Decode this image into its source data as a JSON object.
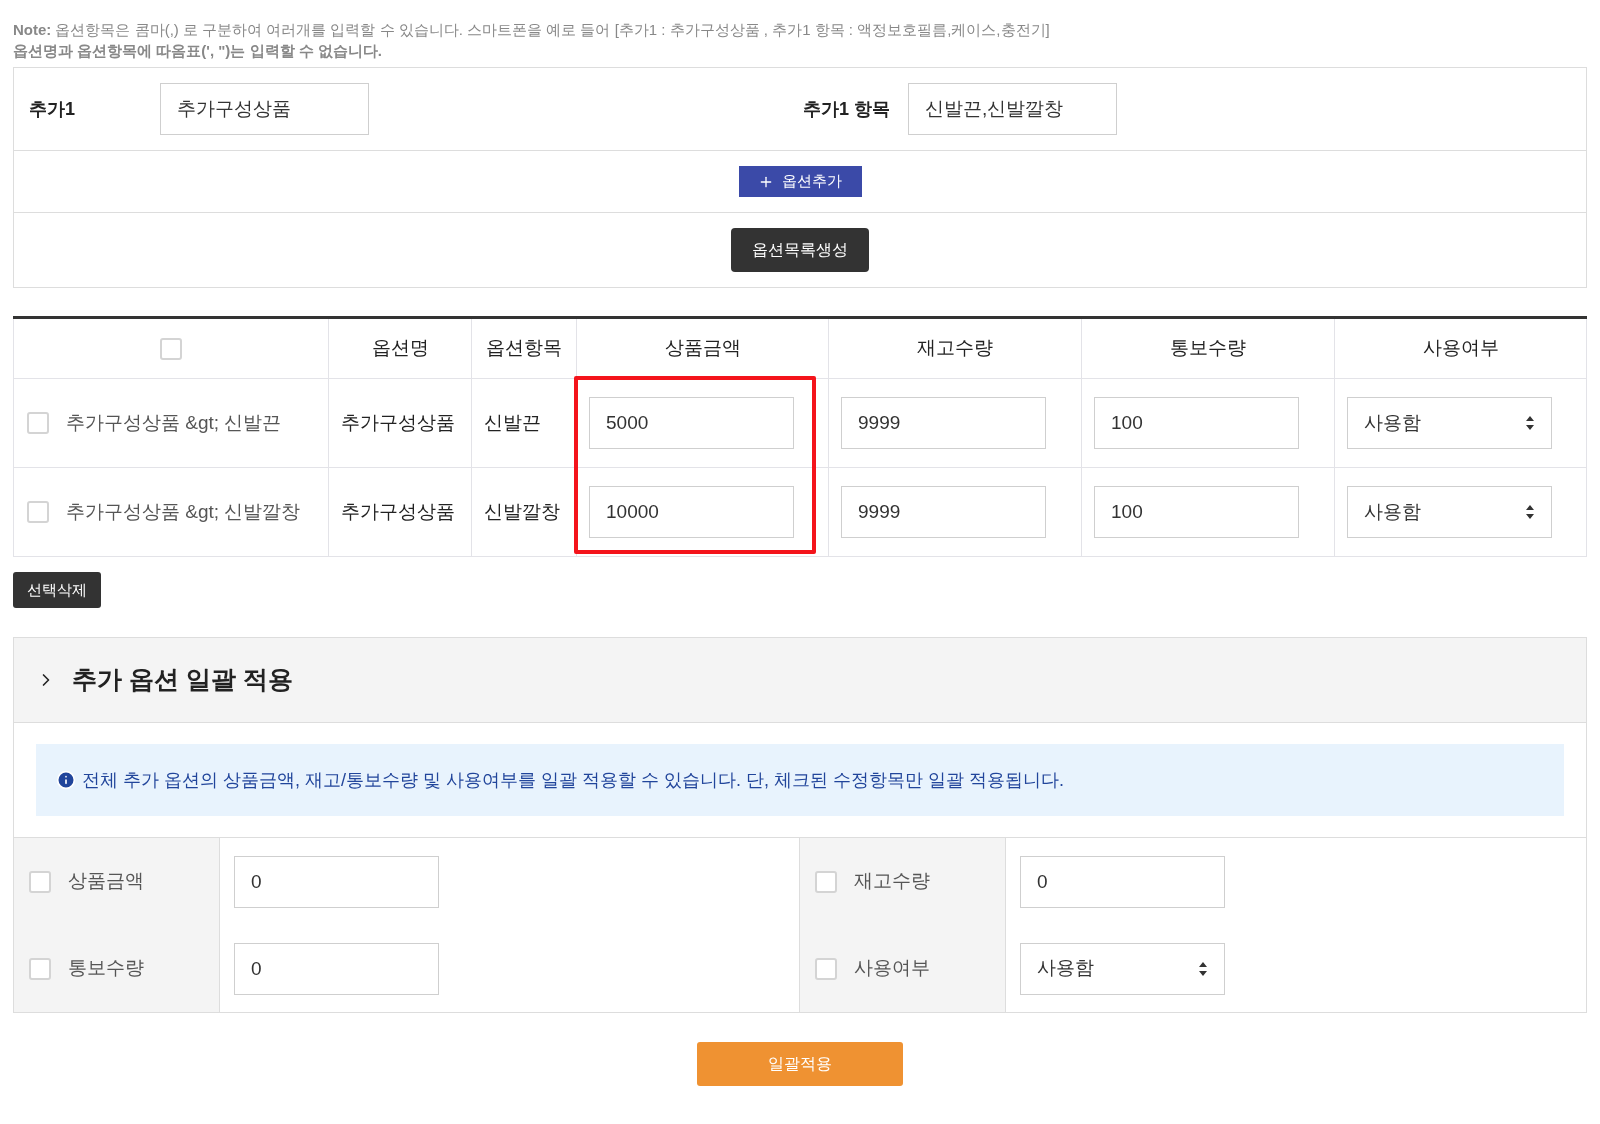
{
  "note": {
    "line_1": "**Note:** 옵션항목은 콤마(,) 로 구분하여 여러개를 입력할 수 있습니다. 스마트폰을 예로 들어 [추가1 : 추가구성상품 , 추가1 항목 : 액정보호필름,케이스,충전기]",
    "line_2": "옵션명과 옵션항목에 따옴표(', \")는 입력할 수 없습니다."
  },
  "option_form": {
    "fields": [
      {
        "label": "추가1",
        "value": "추가구성상품"
      },
      {
        "label": "추가1 항목",
        "value": "신발끈,신발깔창"
      }
    ],
    "add_button": "옵션추가",
    "generate_button": "옵션목록생성"
  },
  "table": {
    "select_all_checked": false,
    "columns": [
      {
        "label": "옵션명",
        "kind": "text",
        "highlighted": false
      },
      {
        "label": "옵션항목",
        "kind": "text",
        "highlighted": false
      },
      {
        "label": "상품금액",
        "kind": "input",
        "highlighted": true
      },
      {
        "label": "재고수량",
        "kind": "input",
        "highlighted": false
      },
      {
        "label": "통보수량",
        "kind": "input",
        "highlighted": false
      },
      {
        "label": "사용여부",
        "kind": "select",
        "highlighted": false
      }
    ],
    "rows": [
      {
        "checked": false,
        "title": "추가구성상품 &gt; 신발끈",
        "values": [
          "추가구성상품",
          "신발끈",
          "5000",
          "9999",
          "100",
          "사용함"
        ]
      },
      {
        "checked": false,
        "title": "추가구성상품 &gt; 신발깔창",
        "values": [
          "추가구성상품",
          "신발깔창",
          "10000",
          "9999",
          "100",
          "사용함"
        ]
      }
    ]
  },
  "delete_button": "선택삭제",
  "bulk": {
    "title": "추가 옵션 일괄 적용",
    "expanded": false,
    "info": "전체 추가 옵션의 상품금액, 재고/통보수량 및 사용여부를 일괄 적용할 수 있습니다. 단, 체크된 수정항목만 일괄 적용됩니다.",
    "fields": [
      {
        "kind": "input",
        "label": "상품금액",
        "checked": false,
        "value": "0"
      },
      {
        "kind": "input",
        "label": "재고수량",
        "checked": false,
        "value": "0"
      },
      {
        "kind": "input",
        "label": "통보수량",
        "checked": false,
        "value": "0"
      },
      {
        "kind": "select",
        "label": "사용여부",
        "checked": false,
        "value": "사용함"
      }
    ]
  },
  "apply_button": "일괄적용"
}
